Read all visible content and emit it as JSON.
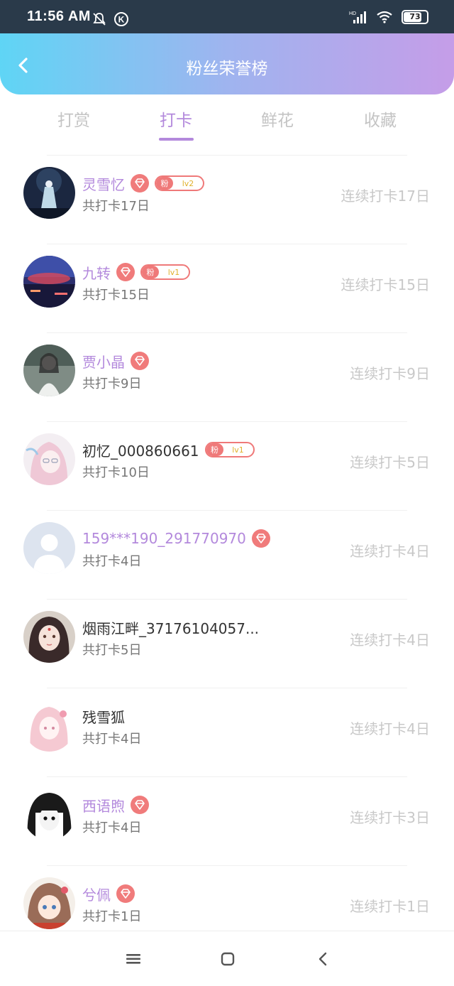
{
  "status": {
    "time": "11:56 AM",
    "battery": "73",
    "network": "HD"
  },
  "header": {
    "title": "粉丝荣誉榜"
  },
  "tabs": [
    "打赏",
    "打卡",
    "鲜花",
    "收藏"
  ],
  "active_tab": "打卡",
  "rows": [
    {
      "name": "灵雪忆",
      "name_color": "purple",
      "vip": true,
      "fan_badge": "粉",
      "fan_level": "lv2",
      "total": "共打卡17日",
      "consecutive": "连续打卡17日"
    },
    {
      "name": "九转",
      "name_color": "purple",
      "vip": true,
      "fan_badge": "粉",
      "fan_level": "lv1",
      "total": "共打卡15日",
      "consecutive": "连续打卡15日"
    },
    {
      "name": "贾小晶",
      "name_color": "purple",
      "vip": true,
      "total": "共打卡9日",
      "consecutive": "连续打卡9日"
    },
    {
      "name": "初忆_000860661",
      "name_color": "plain",
      "vip": false,
      "fan_badge": "粉",
      "fan_level": "lv1",
      "total": "共打卡10日",
      "consecutive": "连续打卡5日"
    },
    {
      "name": "159***190_291770970",
      "name_color": "purple",
      "vip": true,
      "total": "共打卡4日",
      "consecutive": "连续打卡4日"
    },
    {
      "name": "烟雨江畔_37176104057...",
      "name_color": "plain",
      "vip": false,
      "total": "共打卡5日",
      "consecutive": "连续打卡4日"
    },
    {
      "name": "残雪狐",
      "name_color": "plain",
      "vip": false,
      "total": "共打卡4日",
      "consecutive": "连续打卡4日"
    },
    {
      "name": "西语煦",
      "name_color": "purple",
      "vip": true,
      "total": "共打卡4日",
      "consecutive": "连续打卡3日"
    },
    {
      "name": "兮佩",
      "name_color": "purple",
      "vip": true,
      "total": "共打卡1日",
      "consecutive": "连续打卡1日"
    }
  ],
  "colors": {
    "accent": "#b389dc",
    "badge": "#ef7979",
    "header_start": "#5fd5f5",
    "header_end": "#c59de8"
  }
}
